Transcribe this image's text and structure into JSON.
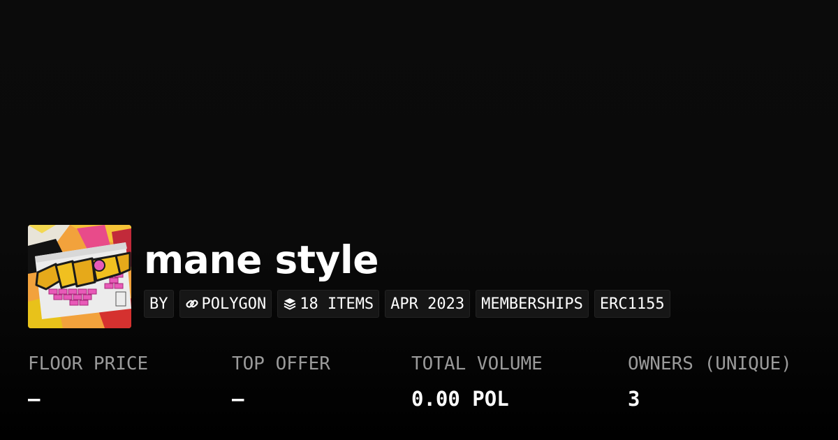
{
  "collection": {
    "name": "mane style",
    "thumbnail_icon": "collection-artwork-graffiti"
  },
  "tags": {
    "by": "BY",
    "chain": "POLYGON",
    "chain_icon": "link-icon",
    "items": "18 ITEMS",
    "items_icon": "layers-icon",
    "date": "APR 2023",
    "category": "MEMBERSHIPS",
    "standard": "ERC1155"
  },
  "stats": {
    "floor_price": {
      "label": "FLOOR PRICE",
      "value": "–"
    },
    "top_offer": {
      "label": "TOP OFFER",
      "value": "–"
    },
    "total_volume": {
      "label": "TOTAL VOLUME",
      "value": "0.00 POL"
    },
    "owners": {
      "label": "OWNERS (UNIQUE)",
      "value": "3"
    }
  },
  "colors": {
    "background": "#0a0a0a",
    "text": "#ffffff",
    "muted_label": "#9a9a9a",
    "tag_background": "#161616"
  }
}
